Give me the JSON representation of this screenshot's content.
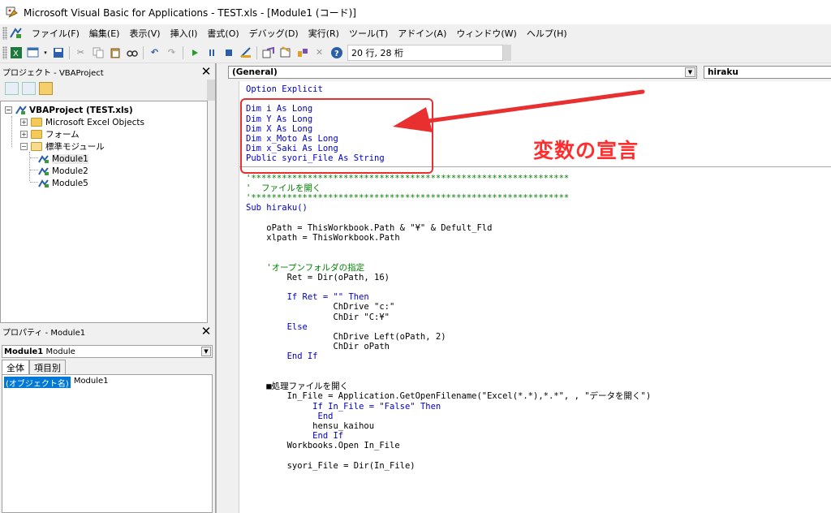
{
  "window": {
    "title": "Microsoft Visual Basic for Applications - TEST.xls - [Module1 (コード)]"
  },
  "menu": {
    "items": [
      "ファイル(F)",
      "編集(E)",
      "表示(V)",
      "挿入(I)",
      "書式(O)",
      "デバッグ(D)",
      "実行(R)",
      "ツール(T)",
      "アドイン(A)",
      "ウィンドウ(W)",
      "ヘルプ(H)"
    ]
  },
  "toolbar": {
    "position": "20 行, 28 桁"
  },
  "project": {
    "title": "プロジェクト - VBAProject",
    "root": "VBAProject (TEST.xls)",
    "nodes": [
      "Microsoft Excel Objects",
      "フォーム",
      "標準モジュール"
    ],
    "modules": [
      "Module1",
      "Module2",
      "Module5"
    ]
  },
  "properties": {
    "title": "プロパティ - Module1",
    "object_name": "Module1",
    "object_type": "Module",
    "tabs": [
      "全体",
      "項目別"
    ],
    "row_key": "(オブジェクト名)",
    "row_value": "Module1"
  },
  "code": {
    "object_combo": "(General)",
    "proc_combo": "hiraku",
    "lines": {
      "l1": "Option Explicit",
      "l3": "Dim i As Long",
      "l4": "Dim Y As Long",
      "l5": "Dim X As Long",
      "l6": "Dim x_Moto As Long",
      "l7": "Dim x_Saki As Long",
      "l8": "Public syori_File As String",
      "l10": "'**************************************************************",
      "l11": "'  ファイルを開く",
      "l12": "'**************************************************************",
      "l13": "Sub hiraku()",
      "l15": "    oPath = ThisWorkbook.Path & \"¥\" & Defult_Fld",
      "l16": "    xlpath = ThisWorkbook.Path",
      "l19": "    'オープンフォルダの指定",
      "l20": "        Ret = Dir(oPath, 16)",
      "l22a": "        If Ret = \"\" ",
      "l22b": "Then",
      "l23": "                 ChDrive \"c:\"",
      "l24": "                 ChDir \"C:¥\"",
      "l25": "        Else",
      "l26": "                 ChDrive Left(oPath, 2)",
      "l27": "                 ChDir oPath",
      "l28": "        End If",
      "l31": "    ■処理ファイルを開く",
      "l32": "        In_File = Application.GetOpenFilename(\"Excel(*.*),*.*\", , \"データを開く\")",
      "l33a": "             If In_File = \"False\" ",
      "l33b": "Then",
      "l34": "              End",
      "l35": "             hensu_kaihou",
      "l36": "             End If",
      "l37": "        Workbooks.Open In_File",
      "l39": "        syori_File = Dir(In_File)"
    }
  },
  "annotation": {
    "label": "変数の宣言",
    "color": "#ff2d2d"
  }
}
